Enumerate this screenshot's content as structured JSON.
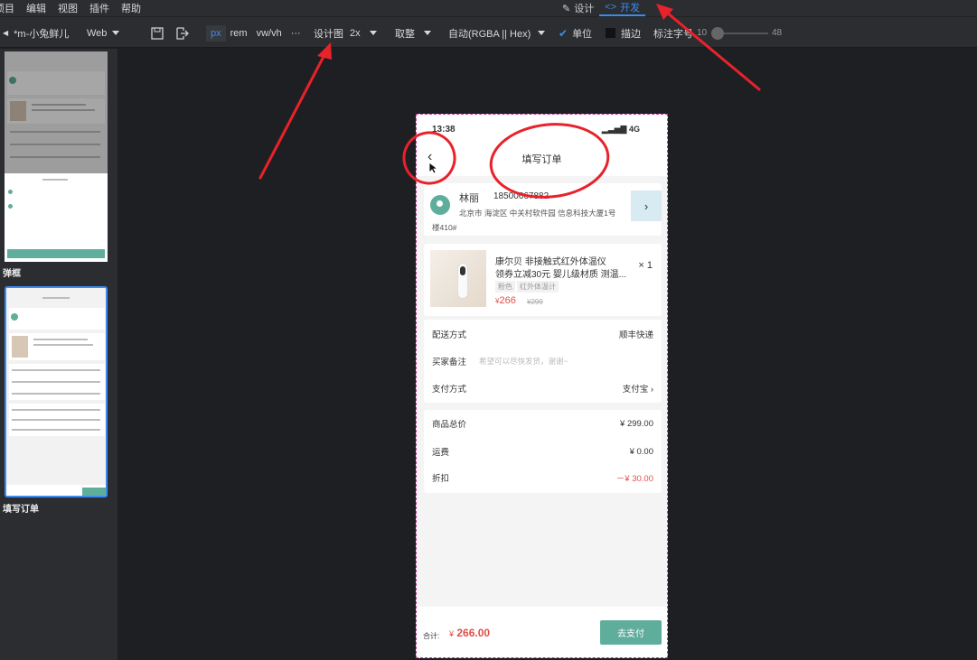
{
  "menubar": {
    "items": [
      "项目",
      "编辑",
      "视图",
      "插件",
      "帮助"
    ],
    "mode_design": "设计",
    "mode_dev": "开发"
  },
  "toolbar": {
    "project": "*m-小兔鲜儿",
    "platform": "Web",
    "units": [
      "px",
      "rem",
      "vw/vh"
    ],
    "more": "···",
    "design_label": "设计图",
    "scale": "2x",
    "rounding": "取整",
    "color_format": "自动(RGBA || Hex)",
    "unit_label": "单位",
    "stroke_label": "描边",
    "font_label": "标注字号",
    "font_min": "10",
    "font_max": "48"
  },
  "panel": {
    "thumb1_label": "弹框",
    "thumb2_label": "填写订单"
  },
  "phone": {
    "time": "13:38",
    "signal": "4G",
    "title": "填写订单",
    "address": {
      "name": "林丽",
      "phone": "18500667882",
      "line1": "北京市   海淀区   中关村软件园   信息科技大厦1号",
      "line2": "楼410#"
    },
    "goods": {
      "title1": "康尔贝 非接触式红外体温仪",
      "title2": "领券立减30元 婴儿级材质 测温...",
      "tag1": "粉色",
      "tag2": "红外体温计",
      "price_symbol": "¥",
      "price": "266",
      "old_price": "¥299",
      "qty": "× 1"
    },
    "rows1": [
      {
        "label": "配送方式",
        "value": "顺丰快递"
      },
      {
        "label": "买家备注",
        "hint": "希望可以尽快发货，谢谢~"
      },
      {
        "label": "支付方式",
        "value": "支付宝  ›"
      }
    ],
    "rows2": [
      {
        "label": "商品总价",
        "value": "¥ 299.00"
      },
      {
        "label": "运费",
        "value": "¥ 0.00"
      },
      {
        "label": "折扣",
        "value": "－¥ 30.00"
      }
    ],
    "total_label": "合计:",
    "total_symbol": "¥",
    "total": "266.00",
    "pay_button": "去支付"
  },
  "colors": {
    "accent": "#3b8cf0",
    "brand_green": "#5fae9c",
    "price_red": "#e0504a",
    "annotation_red": "#e8222a"
  }
}
